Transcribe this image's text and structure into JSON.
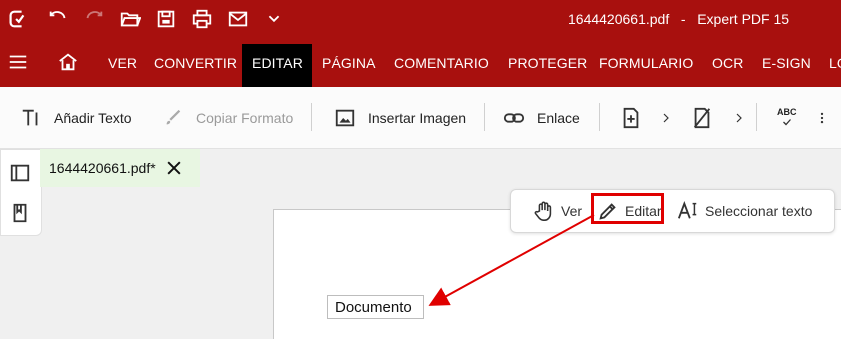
{
  "window": {
    "title": "1644420661.pdf   -   Expert PDF 15"
  },
  "menu": {
    "items": [
      "VER",
      "CONVERTIR",
      "EDITAR",
      "PÁGINA",
      "COMENTARIO",
      "PROTEGER",
      "FORMULARIO",
      "OCR",
      "E-SIGN",
      "LO"
    ],
    "active": "EDITAR"
  },
  "toolbar": {
    "add_text": "Añadir Texto",
    "copy_format": "Copiar Formato",
    "insert_image": "Insertar Imagen",
    "link": "Enlace",
    "abc": "ABC"
  },
  "document": {
    "tab_title": "1644420661.pdf*",
    "text_box": "Documento"
  },
  "modes": {
    "view": "Ver",
    "edit": "Editar",
    "select_text": "Seleccionar texto"
  },
  "colors": {
    "brand": "#a8100e",
    "active_tab": "#000000",
    "highlight": "#e00000",
    "doc_tab": "#e8f6e2"
  }
}
